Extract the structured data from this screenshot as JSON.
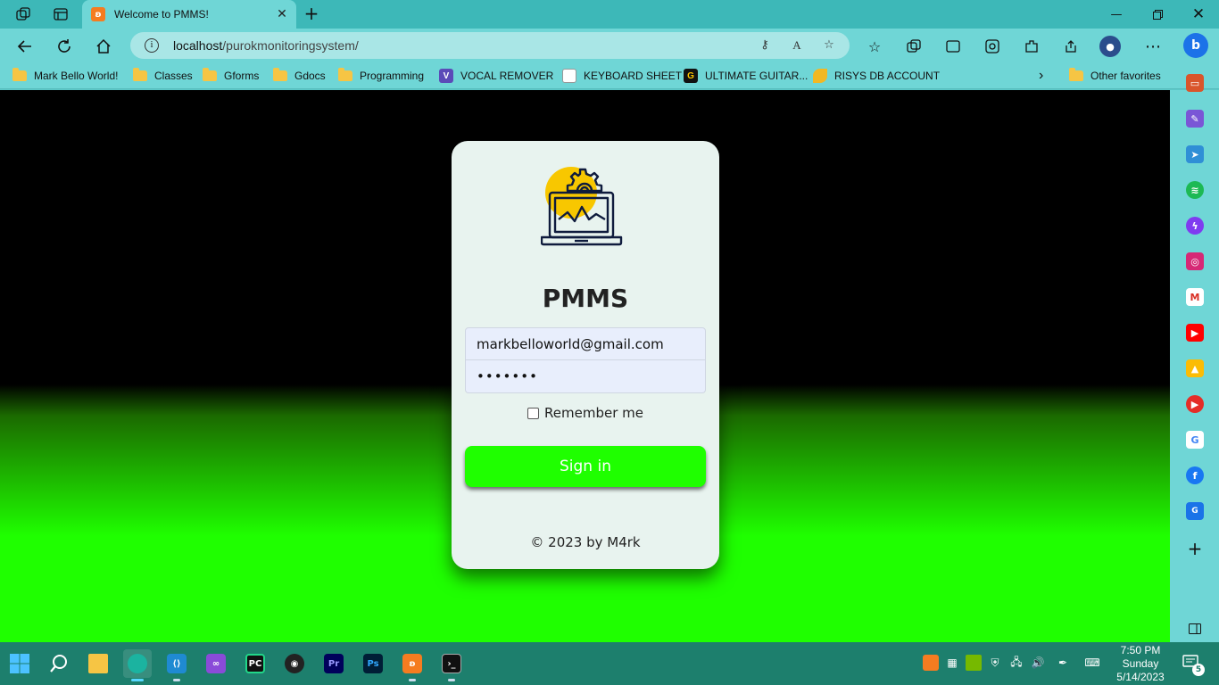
{
  "browser": {
    "tab": {
      "title": "Welcome to PMMS!",
      "favicon_color": "#f57c20"
    },
    "url": {
      "host": "localhost",
      "path": "/purokmonitoringsystem/"
    },
    "bookmarks": [
      {
        "label": "Mark Bello World!",
        "icon": "folder-icon"
      },
      {
        "label": "Classes",
        "icon": "folder-icon"
      },
      {
        "label": "Gforms",
        "icon": "folder-icon"
      },
      {
        "label": "Gdocs",
        "icon": "folder-icon"
      },
      {
        "label": "Programming",
        "icon": "folder-icon"
      },
      {
        "label": "VOCAL REMOVER",
        "icon": "vocal-remover-icon",
        "glyph": "V"
      },
      {
        "label": "KEYBOARD SHEET",
        "icon": "keyboard-sheet-icon"
      },
      {
        "label": "ULTIMATE GUITAR...",
        "icon": "ultimate-guitar-icon",
        "glyph": "G"
      },
      {
        "label": "RISYS DB ACCOUNT",
        "icon": "risys-icon"
      }
    ],
    "other_favorites": "Other favorites"
  },
  "login": {
    "brand": "PMMS",
    "email_value": "markbelloworld@gmail.com",
    "password_mask": "•••••••",
    "remember_label": "Remember me",
    "signin_label": "Sign in",
    "footer": "© 2023 by M4rk",
    "accent": "#1fff00"
  },
  "taskbar": {
    "clock": {
      "time": "7:50 PM",
      "day": "Sunday",
      "date": "5/14/2023"
    },
    "notifications": "5"
  },
  "colors": {
    "browser_chrome": "#6fd6d6",
    "taskbar": "#1d7f6d",
    "page_top": "#000000",
    "page_bottom": "#1fff00"
  }
}
